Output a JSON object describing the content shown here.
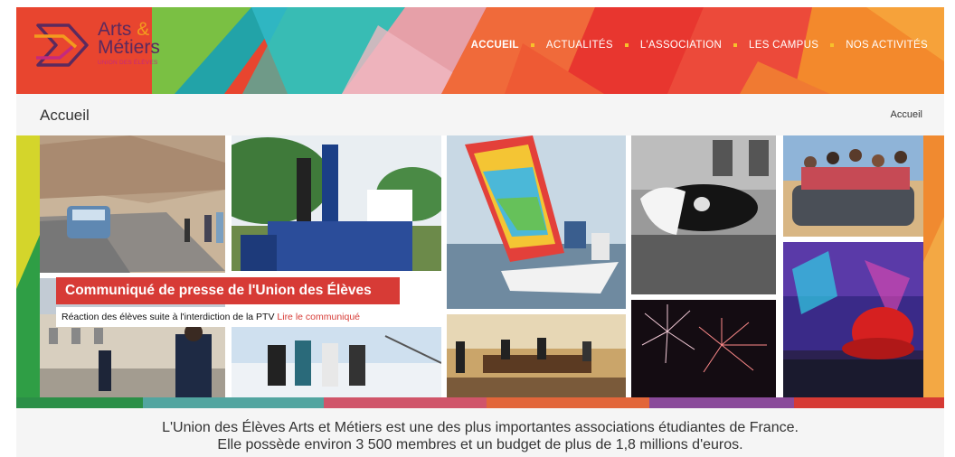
{
  "logo": {
    "word1": "Arts",
    "ampersand": "&",
    "word2": "Métiers",
    "subtitle": "UNION DES ÉLÈVES"
  },
  "nav": {
    "items": [
      {
        "label": "ACCUEIL",
        "active": true
      },
      {
        "label": "ACTUALITÉS",
        "active": false
      },
      {
        "label": "L'ASSOCIATION",
        "active": false
      },
      {
        "label": "LES CAMPUS",
        "active": false
      },
      {
        "label": "NOS ACTIVITÉS",
        "active": false
      }
    ]
  },
  "page": {
    "title": "Accueil",
    "breadcrumb": "Accueil"
  },
  "press": {
    "title": "Communiqué de presse de l'Union des Élèves",
    "text": "Réaction des élèves suite à l'interdiction de la PTV",
    "link": "Lire le communiqué"
  },
  "description": {
    "line1": "L'Union des Élèves Arts et Métiers est une des plus importantes associations étudiantes de France.",
    "line2": "Elle possède environ 3 500 membres et un budget de plus de 1,8 millions d'euros."
  },
  "colors": {
    "accent_red": "#d73b36",
    "nav_bullet": "#f7c12b",
    "logo_purple": "#5b2a5e",
    "logo_magenta": "#c6297c",
    "logo_orange": "#f39a1e"
  }
}
